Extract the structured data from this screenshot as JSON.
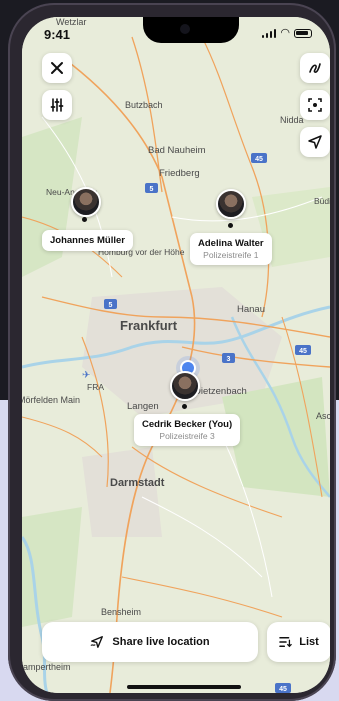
{
  "status_bar": {
    "time": "9:41"
  },
  "map": {
    "city_labels": [
      "Wetzlar",
      "Butzbach",
      "Nidda",
      "Bad Nauheim",
      "Friedberg",
      "Neu-Anspach",
      "Büdingen",
      "Homburg vor der Höhe",
      "Hanau",
      "Frankfurt",
      "Langen",
      "Dietzenbach",
      "Darmstadt",
      "Bensheim",
      "Lampertheim",
      "Mörfelden Main",
      "Aschaffenburg",
      "FRA"
    ],
    "road_badges": [
      "45",
      "5",
      "5",
      "3",
      "45",
      "45"
    ]
  },
  "people": [
    {
      "name": "Johannes Müller",
      "subtitle": ""
    },
    {
      "name": "Adelina Walter",
      "subtitle": "Polizeistreife 1"
    },
    {
      "name": "Cedrik Becker (You)",
      "subtitle": "Polizeistreife 3"
    }
  ],
  "controls": {
    "close_icon": "close-icon",
    "filter_icon": "sliders-icon",
    "draw_icon": "pen-scribble-icon",
    "focus_icon": "scan-focus-icon",
    "locate_icon": "navigation-arrow-icon"
  },
  "bottom": {
    "share_label": "Share live location",
    "list_label": "List"
  },
  "colors": {
    "map_bg": "#e7ecdc",
    "water": "#a9d3e8",
    "road": "#f0a35c",
    "user_dot": "#4f86ee"
  }
}
